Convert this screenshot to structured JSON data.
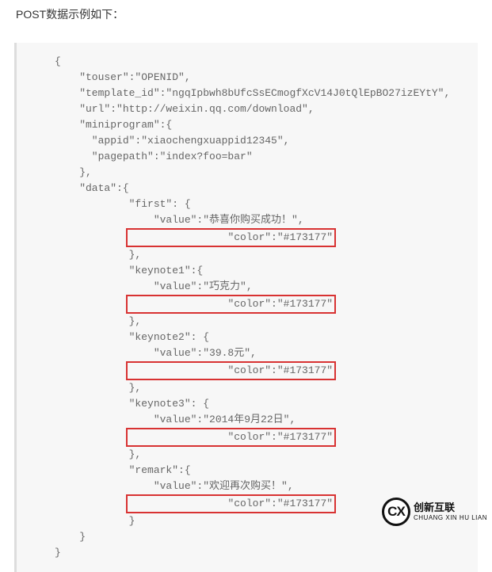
{
  "heading": "POST数据示例如下：",
  "code": {
    "l01": "{",
    "l02": "    \"touser\":\"OPENID\",",
    "l03": "    \"template_id\":\"ngqIpbwh8bUfcSsECmogfXcV14J0tQlEpBO27izEYtY\",",
    "l04": "    \"url\":\"http://weixin.qq.com/download\",",
    "l05": "    \"miniprogram\":{",
    "l06": "      \"appid\":\"xiaochengxuappid12345\",",
    "l07": "      \"pagepath\":\"index?foo=bar\"",
    "l08": "    },",
    "l09": "    \"data\":{",
    "l10": "            \"first\": {",
    "l11": "                \"value\":\"恭喜你购买成功！\",",
    "l12_hl": "                \"color\":\"#173177\"",
    "l13": "            },",
    "l14": "            \"keynote1\":{",
    "l15": "                \"value\":\"巧克力\",",
    "l16_hl": "                \"color\":\"#173177\"",
    "l17": "            },",
    "l18": "            \"keynote2\": {",
    "l19": "                \"value\":\"39.8元\",",
    "l20_hl": "                \"color\":\"#173177\"",
    "l21": "            },",
    "l22": "            \"keynote3\": {",
    "l23": "                \"value\":\"2014年9月22日\",",
    "l24_hl": "                \"color\":\"#173177\"",
    "l25": "            },",
    "l26": "            \"remark\":{",
    "l27": "                \"value\":\"欢迎再次购买！\",",
    "l28_hl": "                \"color\":\"#173177\"",
    "l29": "            }",
    "l30": "    }",
    "l31": "}"
  },
  "watermark": {
    "logo": "CX",
    "text": "创新互联",
    "sub": "CHUANG XIN HU LIAN"
  }
}
